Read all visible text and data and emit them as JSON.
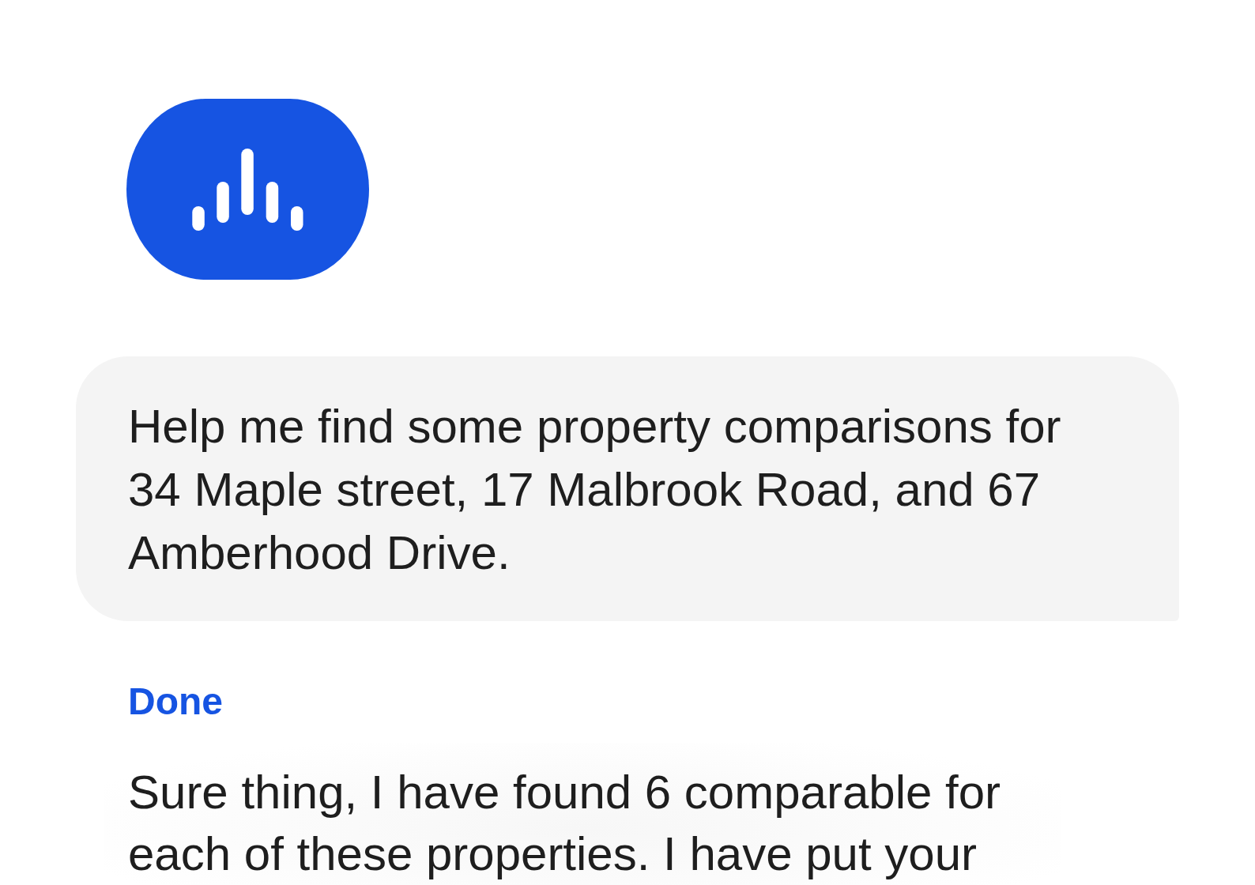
{
  "messages": [
    {
      "kind": "avatar"
    },
    {
      "kind": "user",
      "text": "Help me find some property comparisons for 34 Maple street, 17 Malbrook Road, and 67 Amberhood Drive."
    },
    {
      "kind": "status",
      "text": "Done"
    },
    {
      "kind": "assistant",
      "text": "Sure thing, I have found 6 comparable for each of these properties. I have put your"
    }
  ]
}
